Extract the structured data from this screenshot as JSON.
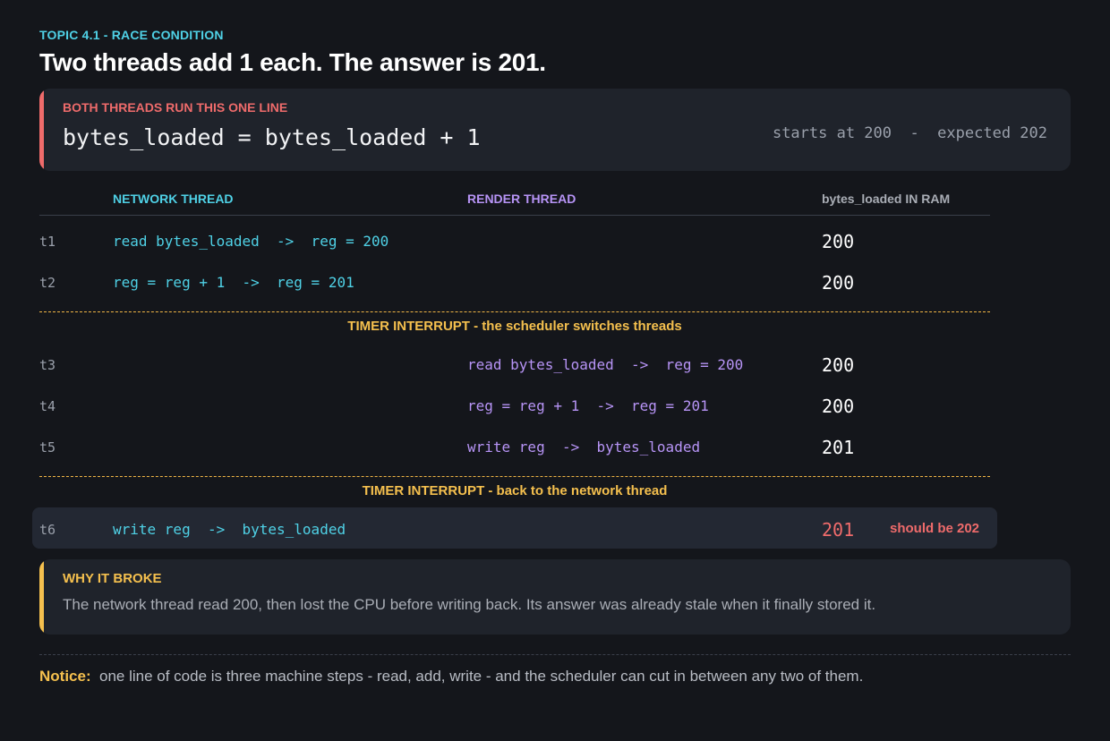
{
  "topic": "TOPIC 4.1  -  RACE CONDITION",
  "title": "Two threads add 1 each. The answer is 201.",
  "code_card": {
    "label": "BOTH THREADS RUN THIS ONE LINE",
    "code": "bytes_loaded = bytes_loaded + 1",
    "meta": "starts at 200  -  expected 202"
  },
  "columns": {
    "network": "NETWORK THREAD",
    "render": "RENDER THREAD",
    "ram": "bytes_loaded IN RAM"
  },
  "rows": [
    {
      "t": "t1",
      "network": "read bytes_loaded  ->  reg = 200",
      "render": "",
      "ram": "200"
    },
    {
      "t": "t2",
      "network": "reg = reg + 1  ->  reg = 201",
      "render": "",
      "ram": "200"
    },
    {
      "t": "t3",
      "network": "",
      "render": "read bytes_loaded  ->  reg = 200",
      "ram": "200"
    },
    {
      "t": "t4",
      "network": "",
      "render": "reg = reg + 1  ->  reg = 201",
      "ram": "200"
    },
    {
      "t": "t5",
      "network": "",
      "render": "write reg  ->  bytes_loaded",
      "ram": "201"
    },
    {
      "t": "t6",
      "network": "write reg  ->  bytes_loaded",
      "render": "",
      "ram": "201",
      "note": "should be 202"
    }
  ],
  "interrupts": [
    "TIMER INTERRUPT  -  the scheduler switches threads",
    "TIMER INTERRUPT  -  back to the network thread"
  ],
  "why": {
    "label": "WHY IT BROKE",
    "text": "The network thread read 200, then lost the CPU before writing back. Its answer was already stale when it finally stored it."
  },
  "notice": {
    "label": "Notice:",
    "text": "one line of code is three machine steps - read, add, write - and the scheduler can cut in between any two of them."
  },
  "colors": {
    "network": "#4fd1e6",
    "render": "#b794f6",
    "alert": "#ef6b6b",
    "warning": "#f5c04e",
    "background": "#14161b",
    "card": "#1f232b"
  }
}
